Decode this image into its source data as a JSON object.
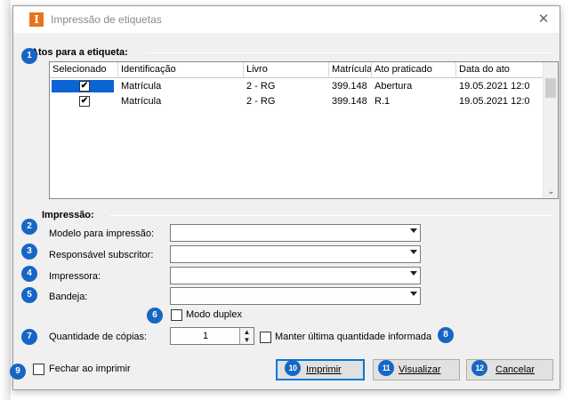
{
  "window": {
    "title": "Impressão de etiquetas",
    "close_glyph": "✕",
    "app_icon_letter": "I"
  },
  "acts_section": {
    "label": "Atos para a etiqueta:"
  },
  "grid": {
    "columns": [
      "Selecionado",
      "Identificação",
      "Livro",
      "Matrícula",
      "Ato praticado",
      "Data do ato"
    ],
    "rows": [
      {
        "selected": true,
        "identificacao": "Matrícula",
        "livro": "2 - RG",
        "matricula": "399.148",
        "ato": "Abertura",
        "data": "19.05.2021 12:0"
      },
      {
        "selected": true,
        "identificacao": "Matrícula",
        "livro": "2 - RG",
        "matricula": "399.148",
        "ato": "R.1",
        "data": "19.05.2021 12:0"
      }
    ],
    "check_glyph": "✔",
    "scroll_down_glyph": "⌄"
  },
  "print_section": {
    "label": "Impressão:",
    "fields": {
      "modelo": {
        "label": "Modelo para impressão:",
        "value": ""
      },
      "responsavel": {
        "label": "Responsável subscritor:",
        "value": ""
      },
      "impressora": {
        "label": "Impressora:",
        "value": ""
      },
      "bandeja": {
        "label": "Bandeja:",
        "value": ""
      }
    },
    "modo_duplex": {
      "label": "Modo duplex",
      "checked": false
    },
    "copias": {
      "label": "Quantidade de cópias:",
      "value": "1"
    },
    "manter_ultima": {
      "label": "Manter última quantidade informada",
      "checked": false
    }
  },
  "footer": {
    "fechar": {
      "label": "Fechar ao imprimir",
      "checked": false
    },
    "buttons": {
      "imprimir": "Imprimir",
      "visualizar": "Visualizar",
      "cancelar": "Cancelar"
    }
  },
  "badges": [
    "1",
    "2",
    "3",
    "4",
    "5",
    "6",
    "7",
    "8",
    "9",
    "10",
    "11",
    "12"
  ],
  "colors": {
    "badge": "#1766c4",
    "selection": "#0a64d6",
    "app_icon": "#e8741d",
    "default_button_border": "#0078d7"
  }
}
